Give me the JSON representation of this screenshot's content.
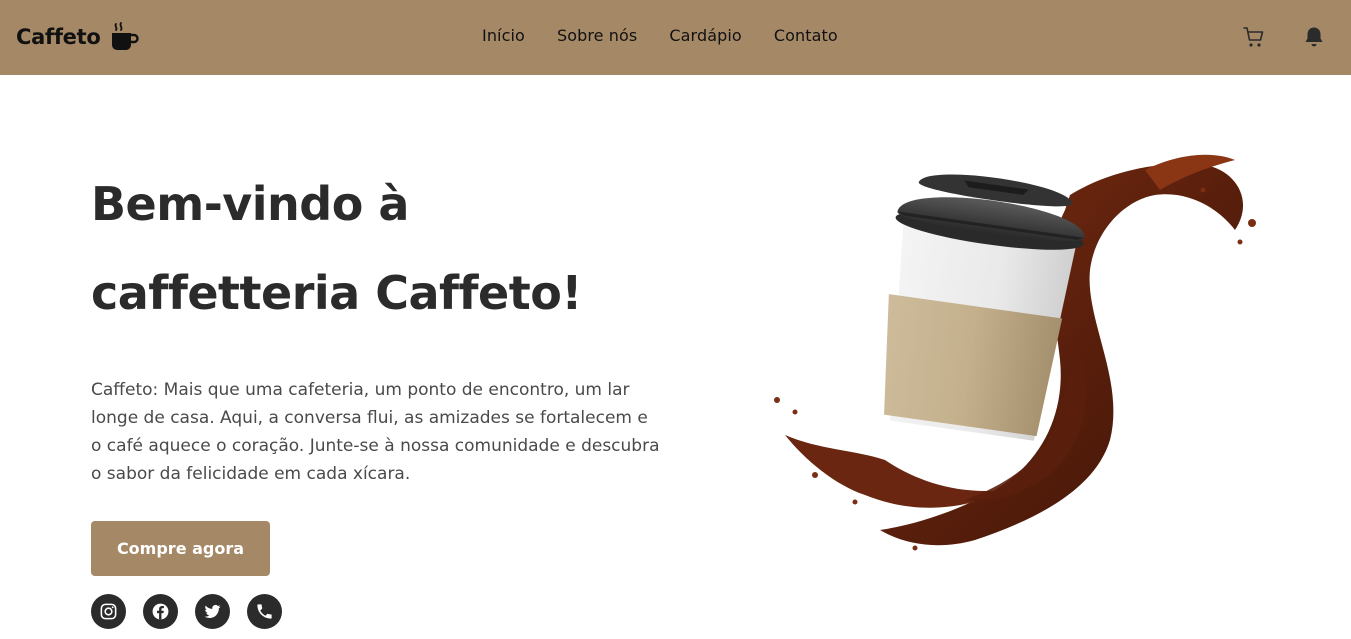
{
  "header": {
    "brand": "Caffeto",
    "brand_icon": "coffee-cup-icon",
    "nav": [
      "Início",
      "Sobre nós",
      "Cardápio",
      "Contato"
    ],
    "actions": [
      {
        "name": "cart-icon"
      },
      {
        "name": "bell-icon"
      }
    ],
    "bg_color": "#a58866"
  },
  "hero": {
    "title_line1": "Bem-vindo à",
    "title_line2": "caffetteria Caffeto!",
    "description": "Caffeto: Mais que uma cafeteria, um ponto de encontro, um lar longe de casa. Aqui, a conversa flui, as amizades se fortalecem e o café aquece o coração. Junte-se à nossa comunidade e descubra o sabor da felicidade em cada xícara.",
    "cta_label": "Compre agora",
    "cta_color": "#a58866"
  },
  "socials": [
    {
      "name": "instagram-icon"
    },
    {
      "name": "facebook-icon"
    },
    {
      "name": "twitter-icon"
    },
    {
      "name": "phone-icon"
    }
  ]
}
